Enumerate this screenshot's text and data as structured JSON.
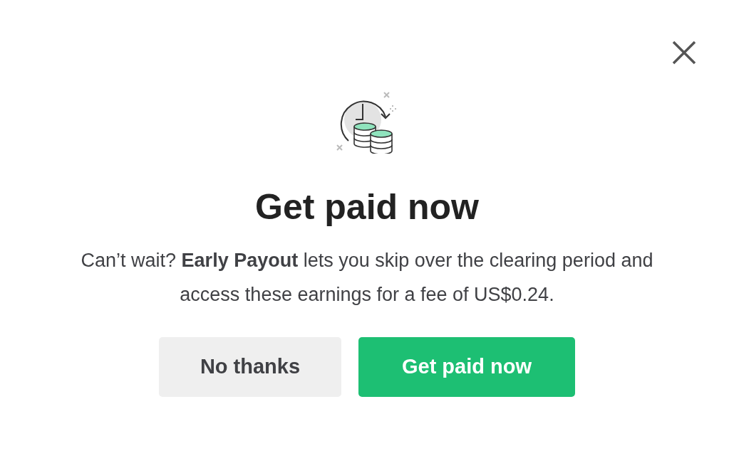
{
  "dialog": {
    "title": "Get paid now",
    "message": "Can’t wait? **Early Payout** lets you skip over the clearing period and access these earnings for a fee of US$0.24.",
    "buttons": [
      {
        "label": "No thanks",
        "kind": "secondary"
      },
      {
        "label": "Get paid now",
        "kind": "primary"
      }
    ]
  }
}
